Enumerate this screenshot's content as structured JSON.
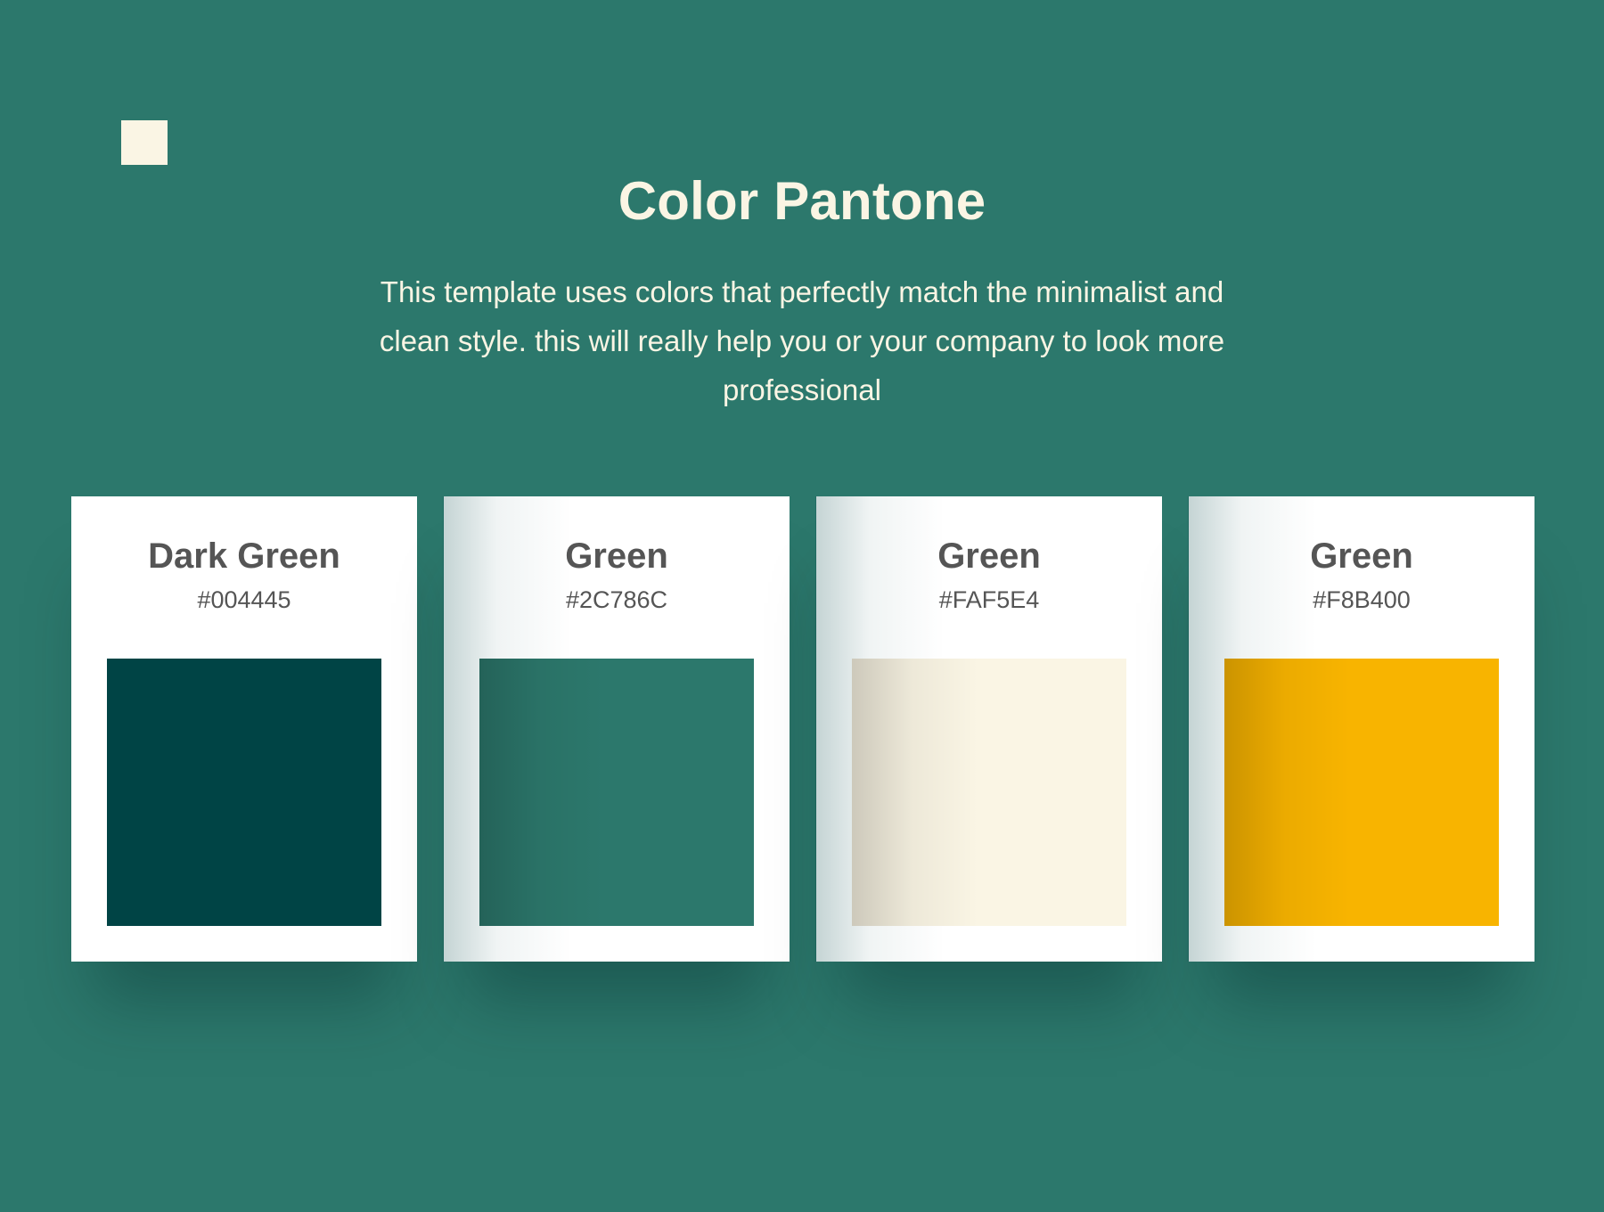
{
  "header": {
    "title": "Color Pantone",
    "description": "This template uses colors that perfectly match the minimalist and clean style. this will really help you or your company to look more professional"
  },
  "colors": [
    {
      "name": "Dark Green",
      "hex": "#004445",
      "swatch": "#004445"
    },
    {
      "name": "Green",
      "hex": "#2C786C",
      "swatch": "#2C786C"
    },
    {
      "name": "Green",
      "hex": "#FAF5E4",
      "swatch": "#FAF5E4"
    },
    {
      "name": "Green",
      "hex": "#F8B400",
      "swatch": "#F8B400"
    }
  ],
  "theme": {
    "background": "#2C786C",
    "logo_square": "#FAF5E4",
    "card_background": "#FFFFFF",
    "card_text": "#555555",
    "title_text": "#FAF5E4"
  }
}
